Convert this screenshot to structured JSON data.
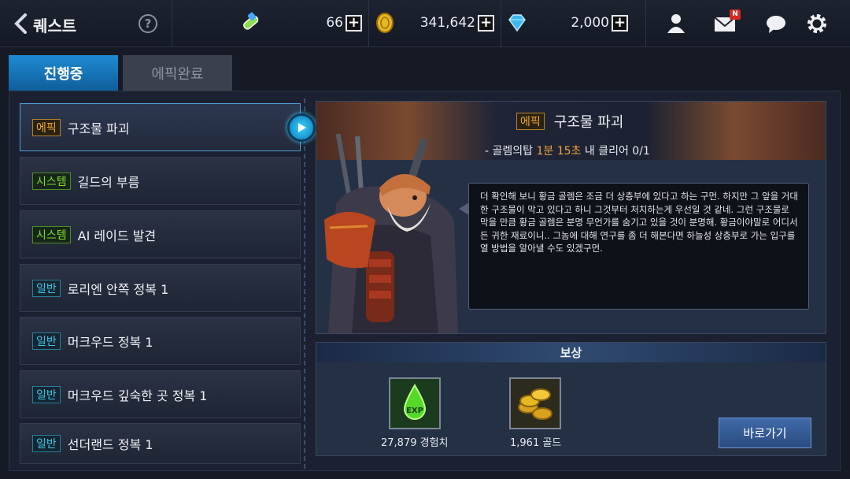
{
  "header": {
    "title": "퀘스트",
    "help_label": "?",
    "resources": {
      "stamina": "66",
      "gold": "341,642",
      "gems": "2,000"
    },
    "plus_label": "+",
    "mail_badge": "N"
  },
  "tabs": [
    {
      "label": "진행중",
      "active": true
    },
    {
      "label": "에픽완료",
      "active": false
    }
  ],
  "quest_list": [
    {
      "tag": "에픽",
      "tag_type": "epic",
      "name": "구조물 파괴",
      "selected": true
    },
    {
      "tag": "시스템",
      "tag_type": "system",
      "name": "길드의 부름"
    },
    {
      "tag": "시스템",
      "tag_type": "system",
      "name": "AI 레이드 발견"
    },
    {
      "tag": "일반",
      "tag_type": "normal",
      "name": "로리엔 안쪽 정복 1"
    },
    {
      "tag": "일반",
      "tag_type": "normal",
      "name": "머크우드 정복 1"
    },
    {
      "tag": "일반",
      "tag_type": "normal",
      "name": "머크우드 깊숙한 곳 정복 1"
    },
    {
      "tag": "일반",
      "tag_type": "normal",
      "name": "선더랜드 정복 1"
    }
  ],
  "detail": {
    "tag": "에픽",
    "title": "구조물 파괴",
    "objective_prefix": "- 골렘의탑 ",
    "objective_time": "1분 15초",
    "objective_suffix": " 내 클리어 0/1",
    "dialogue": "더 확인해 보니 황금 골렘은 조금 더 상층부에 있다고 하는 구먼. 하지만 그 앞을 거대한 구조물이 막고 있다고 하니 그것부터 처치하는게 우선일 것 같네. 그런 구조물로 막을 만큼 황금 골렘은 분명 무언가를 숨기고 있을 것이 분명해. 황금이야말로 어디서든 귀한 재료이니.. 그놈에 대해 연구를 좀 더 해본다면 하늘성 상층부로 가는 입구를 열 방법을 알아낼 수도 있겠구먼."
  },
  "reward": {
    "header": "보상",
    "items": [
      {
        "icon": "exp-potion-icon",
        "label": "27,879 경험치"
      },
      {
        "icon": "gold-coins-icon",
        "label": "1,961 골드"
      }
    ],
    "goto_label": "바로가기"
  },
  "colors": {
    "accent": "#1f8ad2",
    "epic": "#f0a532",
    "system": "#7fdb2a",
    "normal": "#3fc4e6",
    "highlight": "#f3a13a"
  }
}
